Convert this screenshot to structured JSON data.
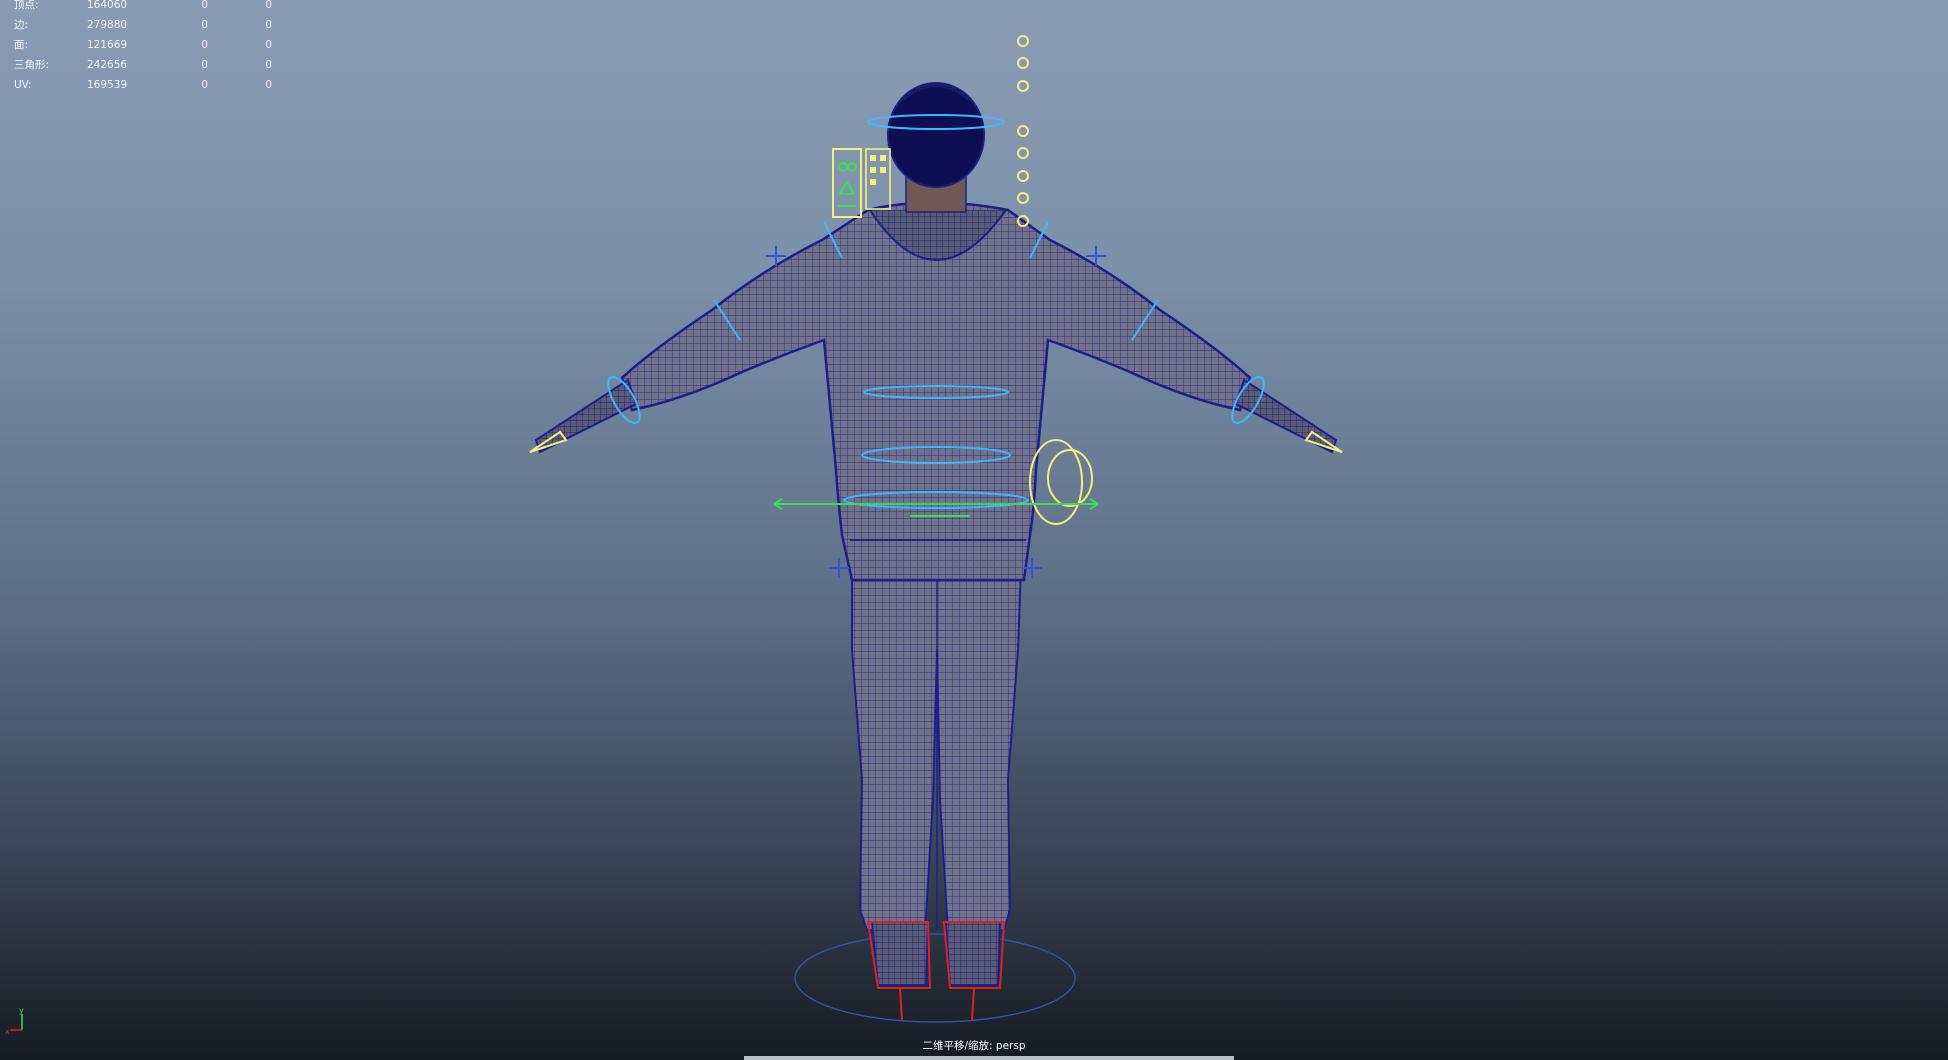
{
  "viewport": {
    "camera_label": "二维平移/缩放: persp"
  },
  "hud": {
    "rows": [
      {
        "label": "顶点:",
        "total": "164060",
        "selected": "0",
        "other": "0"
      },
      {
        "label": "边:",
        "total": "279880",
        "selected": "0",
        "other": "0"
      },
      {
        "label": "面:",
        "total": "121669",
        "selected": "0",
        "other": "0"
      },
      {
        "label": "三角形:",
        "total": "242656",
        "selected": "0",
        "other": "0"
      },
      {
        "label": "UV:",
        "total": "169539",
        "selected": "0",
        "other": "0"
      }
    ]
  },
  "axis": {
    "y": "y",
    "x": "x"
  },
  "colors": {
    "mesh_fill": "#6d6f86",
    "mesh_outline": "#1c1f8a",
    "ctrl_cyan": "#3fb6ff",
    "ctrl_yellow": "#f0f080",
    "ctrl_blue": "#3a4ee0",
    "ctrl_green": "#36e04c",
    "ctrl_red": "#e02020"
  }
}
